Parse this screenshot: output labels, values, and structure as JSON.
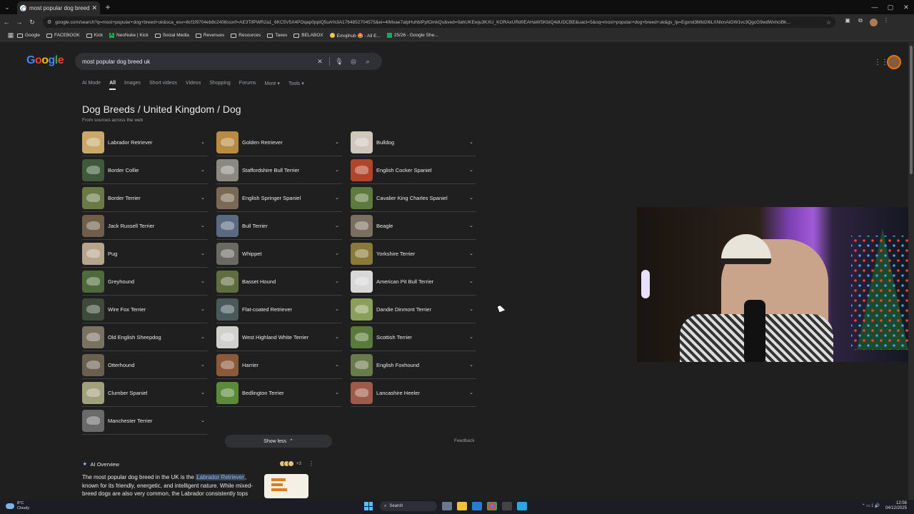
{
  "browser": {
    "tab_title": "most popular dog breed uk - G",
    "url": "google.com/search?q=most+popular+dog+breed+uk&sca_esv=8cf1f9704eb8c2408ssxrf=AE3TifPWR2a1_6KC5V5X4POqap0pplQ5uA%3A1764852704575&ei=4IMxae7alpHuhbIPpfOmkQs&ved=0ahUKEwju3KXU_KORAxURd0EAHaWSKbIQ4dUDCBE&uact=5&oq=most+popular+dog+breed+uk&gs_lp=Egxnd3Mtd2l6LXNlcnAiGW1vc3QgcG9wdWxhciBk...",
    "bookmarks": [
      "Google",
      "FACEBOOK",
      "Kick",
      "NeoNuke | Kick",
      "Social Media",
      "Revenues",
      "Resources",
      "Taxes",
      "BELABOX",
      "Emojihub 🤩 - All E...",
      "25/26 - Google She..."
    ]
  },
  "search": {
    "logo_letters": [
      "G",
      "o",
      "o",
      "g",
      "l",
      "e"
    ],
    "query": "most popular dog breed uk",
    "tabs": [
      "AI Mode",
      "All",
      "Images",
      "Short videos",
      "Videos",
      "Shopping",
      "Forums",
      "More ▾",
      "Tools ▾"
    ],
    "active_tab": "All"
  },
  "results": {
    "heading": "Dog Breeds / United Kingdom / Dog",
    "subheading": "From sources across the web",
    "breeds": [
      {
        "name": "Labrador Retriever",
        "color": "#c9a86a"
      },
      {
        "name": "Golden Retriever",
        "color": "#b98a42"
      },
      {
        "name": "Bulldog",
        "color": "#cfc7bb"
      },
      {
        "name": "Border Collie",
        "color": "#3f5a3a"
      },
      {
        "name": "Staffordshire Bull Terrier",
        "color": "#8a8a80"
      },
      {
        "name": "English Cocker Spaniel",
        "color": "#b0452a"
      },
      {
        "name": "Border Terrier",
        "color": "#6b7a45"
      },
      {
        "name": "English Springer Spaniel",
        "color": "#7a6a55"
      },
      {
        "name": "Cavalier King Charles Spaniel",
        "color": "#5e7a3c"
      },
      {
        "name": "Jack Russell Terrier",
        "color": "#6e5e4a"
      },
      {
        "name": "Bull Terrier",
        "color": "#5a6a80"
      },
      {
        "name": "Beagle",
        "color": "#7a7060"
      },
      {
        "name": "Pug",
        "color": "#b5a58a"
      },
      {
        "name": "Whippet",
        "color": "#6a6a62"
      },
      {
        "name": "Yorkshire Terrier",
        "color": "#8a7a3a"
      },
      {
        "name": "Greyhound",
        "color": "#4e6a3a"
      },
      {
        "name": "Basset Hound",
        "color": "#5e6e3e"
      },
      {
        "name": "American Pit Bull Terrier",
        "color": "#d8d8d8"
      },
      {
        "name": "Wire Fox Terrier",
        "color": "#3e4a3a"
      },
      {
        "name": "Flat-coated Retriever",
        "color": "#4a5a5a"
      },
      {
        "name": "Dandie Dinmont Terrier",
        "color": "#8aa05a"
      },
      {
        "name": "Old English Sheepdog",
        "color": "#7a7260"
      },
      {
        "name": "West Highland White Terrier",
        "color": "#d0d0cc"
      },
      {
        "name": "Scottish Terrier",
        "color": "#5a7a3a"
      },
      {
        "name": "Otterhound",
        "color": "#6a6050"
      },
      {
        "name": "Harrier",
        "color": "#8a5a3a"
      },
      {
        "name": "English Foxhound",
        "color": "#6a7a4a"
      },
      {
        "name": "Clumber Spaniel",
        "color": "#a0a07a"
      },
      {
        "name": "Bedlington Terrier",
        "color": "#5a8a3a"
      },
      {
        "name": "Lancashire Heeler",
        "color": "#a05a4a"
      },
      {
        "name": "Manchester Terrier",
        "color": "#6a6a6a"
      }
    ],
    "show_less": "Show less",
    "feedback": "Feedback"
  },
  "ai_overview": {
    "label": "AI Overview",
    "source_count": "+3",
    "text_before": "The most popular dog breed in the UK is the ",
    "highlight": "Labrador Retriever",
    "text_after": ", known for its friendly, energetic, and intelligent nature. While mixed-breed dogs are also very common, the Labrador consistently tops"
  },
  "taskbar": {
    "weather_temp": "8°C",
    "weather_desc": "Cloudy",
    "search_label": "Search",
    "time": "12:56",
    "date": "04/12/2025"
  },
  "colors": {
    "page_bg": "#1f1f1f",
    "accent": "#8ab4f8",
    "search_bg": "#303134"
  }
}
